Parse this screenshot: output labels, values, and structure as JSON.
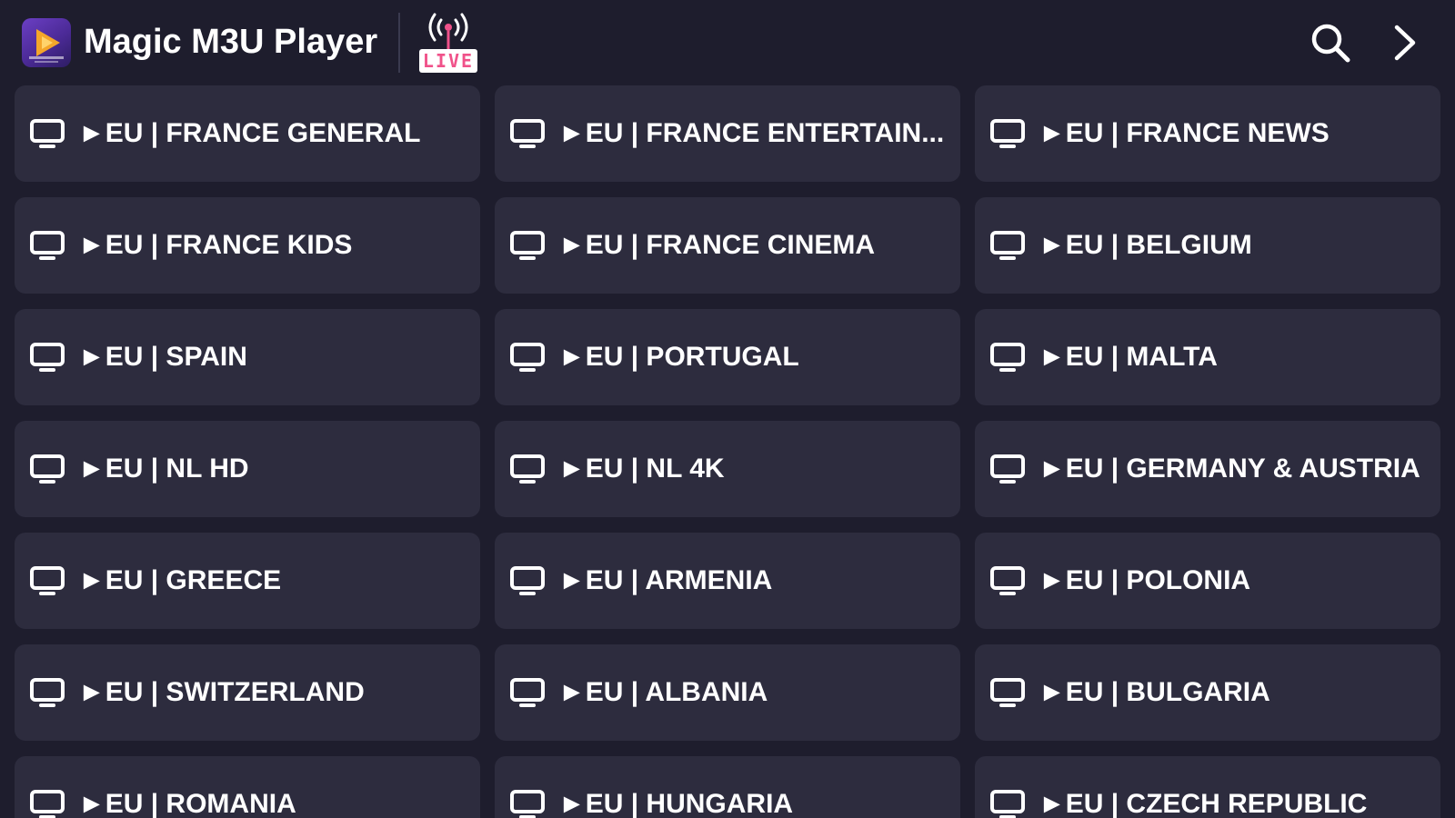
{
  "app": {
    "title": "Magic M3U Player",
    "live_label": "LIVE"
  },
  "icons": {
    "logo": "play-rocket-icon",
    "live": "live-broadcast-icon",
    "search": "search-icon",
    "next": "chevron-right-icon",
    "category": "tv-icon"
  },
  "colors": {
    "background": "#1e1d2d",
    "card": "#2d2c3e",
    "text": "#ffffff",
    "live_accent": "#f0528a"
  },
  "categories": [
    "►EU | FRANCE GENERAL",
    "►EU | FRANCE ENTERTAIN...",
    "►EU | FRANCE NEWS",
    "►EU | FRANCE KIDS",
    "►EU | FRANCE CINEMA",
    "►EU | BELGIUM",
    "►EU | SPAIN",
    "►EU | PORTUGAL",
    "►EU | MALTA",
    "►EU | NL HD",
    "►EU | NL 4K",
    "►EU | GERMANY & AUSTRIA",
    "►EU | GREECE",
    "►EU | ARMENIA",
    "►EU | POLONIA",
    "►EU | SWITZERLAND",
    "►EU | ALBANIA",
    "►EU | BULGARIA",
    "►EU | ROMANIA",
    "►EU | HUNGARIA",
    "►EU | CZECH REPUBLIC"
  ]
}
